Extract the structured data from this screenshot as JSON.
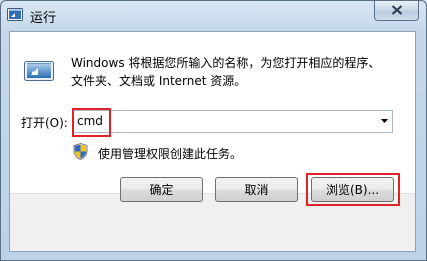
{
  "window": {
    "title": "运行",
    "app_icon": "run-app-icon",
    "close_icon": "close-icon"
  },
  "dialog": {
    "icon": "run-dialog-icon",
    "description_line1": "Windows 将根据您所输入的名称，为您打开相应的程序、",
    "description_line2": "文件夹、文档或 Internet 资源。",
    "open_label": "打开(O):",
    "open_value": "cmd",
    "dropdown_icon": "dropdown-arrow-icon",
    "shield_icon": "uac-shield-icon",
    "admin_note": "使用管理权限创建此任务。"
  },
  "buttons": {
    "ok": "确定",
    "cancel": "取消",
    "browse": "浏览(B)..."
  },
  "colors": {
    "highlight": "#e0222a",
    "title_bg": "#c5d8ea"
  }
}
